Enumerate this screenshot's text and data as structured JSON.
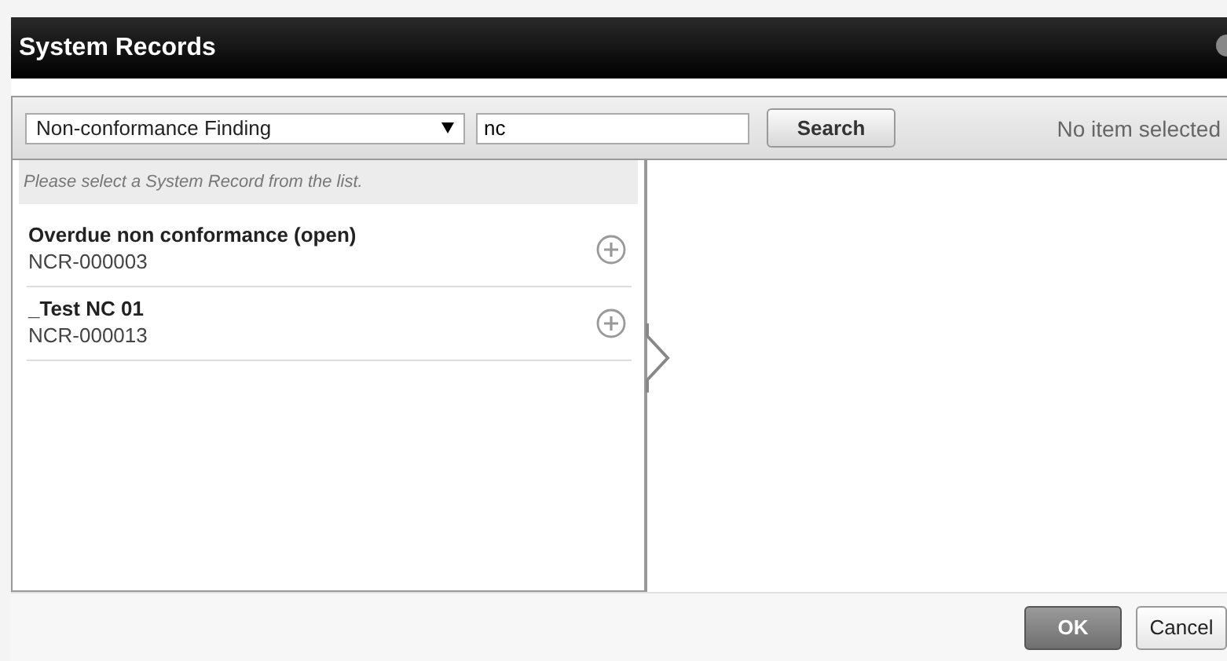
{
  "window": {
    "title": "System Records"
  },
  "toolbar": {
    "record_type": "Non-conformance Finding",
    "search": {
      "value": "nc"
    },
    "search_button": "Search",
    "status": "No item selected"
  },
  "list": {
    "hint": "Please select a System Record from the list.",
    "records": [
      {
        "title": "Overdue non conformance (open)",
        "number": "NCR-000003"
      },
      {
        "title": "_Test NC 01",
        "number": "NCR-000013"
      }
    ]
  },
  "buttons": [
    {
      "label": "OK",
      "kind": "primary"
    },
    {
      "label": "Cancel",
      "kind": "secondary"
    }
  ]
}
